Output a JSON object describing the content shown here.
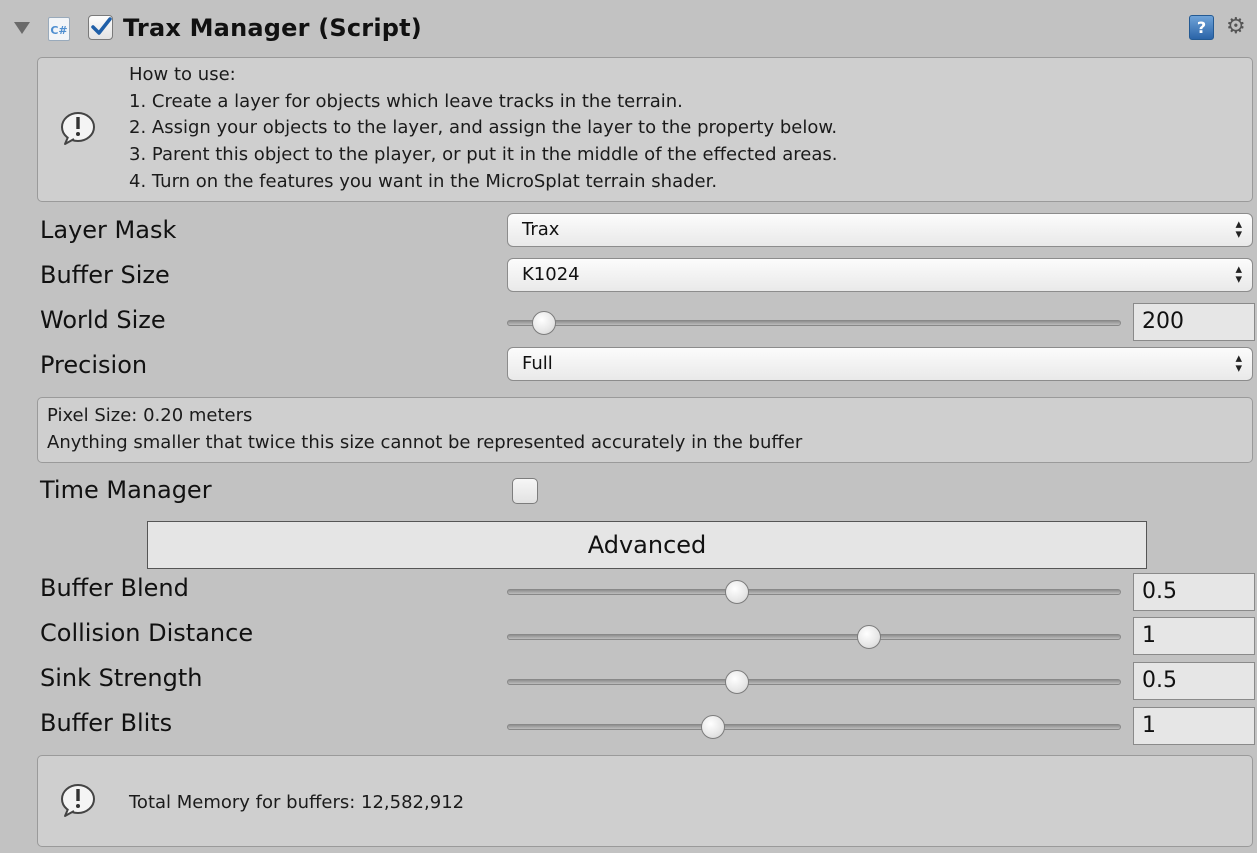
{
  "header": {
    "title": "Trax Manager (Script)",
    "enabled": true,
    "script_icon_label": "C#",
    "icons": [
      "foldout-arrow-icon",
      "csharp-script-icon",
      "help-book-icon",
      "gear-icon"
    ]
  },
  "how_to_box": {
    "lines": [
      "How to use:",
      "1. Create a layer for objects which leave tracks in the terrain.",
      "2. Assign your objects to the layer, and assign the layer to the property below.",
      "3. Parent this object to the player, or put it in the middle of the effected areas.",
      "4. Turn on the features you want in the MicroSplat terrain shader."
    ]
  },
  "properties": {
    "layer_mask": {
      "label": "Layer Mask",
      "value": "Trax"
    },
    "buffer_size": {
      "label": "Buffer Size",
      "value": "K1024"
    },
    "world_size": {
      "label": "World Size",
      "value": "200",
      "slider_fraction": 0.06
    },
    "precision": {
      "label": "Precision",
      "value": "Full"
    }
  },
  "pixel_info": {
    "line1": "Pixel Size: 0.20 meters",
    "line2": "Anything smaller that twice this size cannot be represented accurately in the buffer"
  },
  "time_manager": {
    "label": "Time Manager",
    "checked": false
  },
  "advanced_button": {
    "label": "Advanced"
  },
  "advanced": {
    "buffer_blend": {
      "label": "Buffer Blend",
      "value": "0.5",
      "slider_fraction": 0.375
    },
    "collision_distance": {
      "label": "Collision Distance",
      "value": "1",
      "slider_fraction": 0.59
    },
    "sink_strength": {
      "label": "Sink Strength",
      "value": "0.5",
      "slider_fraction": 0.375
    },
    "buffer_blits": {
      "label": "Buffer Blits",
      "value": "1",
      "slider_fraction": 0.335
    }
  },
  "memory_box": {
    "text": "Total Memory for buffers: 12,582,912"
  },
  "colors": {
    "background": "#c2c2c2",
    "help_icon": "#2a64a8",
    "checkmark": "#1f5fa8"
  }
}
